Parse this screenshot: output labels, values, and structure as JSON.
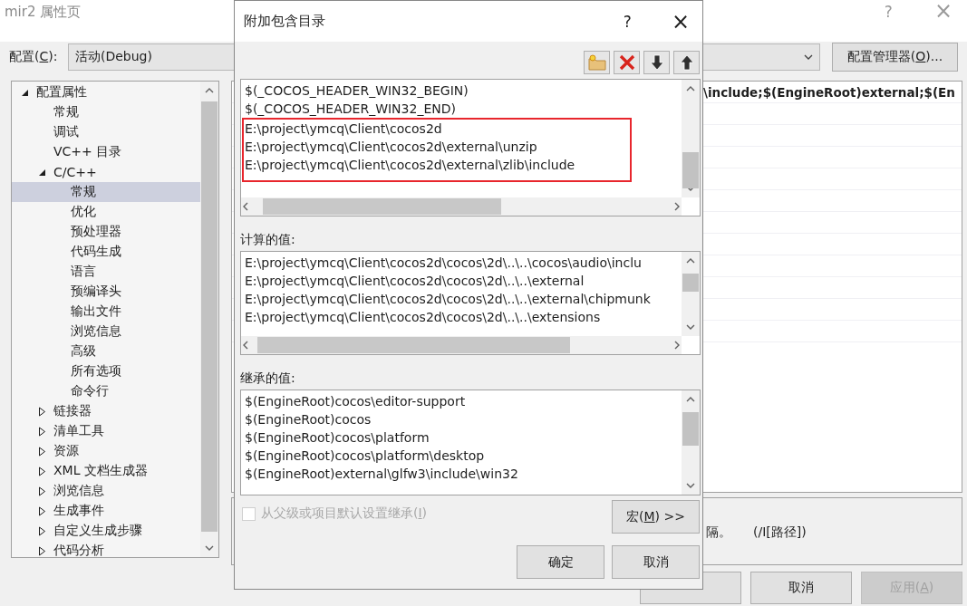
{
  "window": {
    "title": "mir2 属性页",
    "help": "?",
    "close": "×"
  },
  "config": {
    "label": {
      "pre": "配置(",
      "key": "C",
      "post": "):"
    },
    "value": "活动(Debug)",
    "manager_button": {
      "pre": "配置管理器(",
      "key": "O",
      "post": ")..."
    }
  },
  "sidebar": {
    "items": [
      {
        "label": "配置属性",
        "expanded": true,
        "selected": false,
        "children": [
          {
            "label": "常规",
            "selected": false
          },
          {
            "label": "调试",
            "selected": false
          },
          {
            "label": "VC++ 目录",
            "selected": false
          },
          {
            "label": "C/C++",
            "expanded": true,
            "selected": false,
            "children": [
              {
                "label": "常规",
                "selected": true
              },
              {
                "label": "优化",
                "selected": false
              },
              {
                "label": "预处理器",
                "selected": false
              },
              {
                "label": "代码生成",
                "selected": false
              },
              {
                "label": "语言",
                "selected": false
              },
              {
                "label": "预编译头",
                "selected": false
              },
              {
                "label": "输出文件",
                "selected": false
              },
              {
                "label": "浏览信息",
                "selected": false
              },
              {
                "label": "高级",
                "selected": false
              },
              {
                "label": "所有选项",
                "selected": false
              },
              {
                "label": "命令行",
                "selected": false
              }
            ]
          },
          {
            "label": "链接器",
            "expanded": false,
            "selected": false
          },
          {
            "label": "清单工具",
            "expanded": false,
            "selected": false
          },
          {
            "label": "资源",
            "expanded": false,
            "selected": false
          },
          {
            "label": "XML 文档生成器",
            "expanded": false,
            "selected": false
          },
          {
            "label": "浏览信息",
            "expanded": false,
            "selected": false
          },
          {
            "label": "生成事件",
            "expanded": false,
            "selected": false
          },
          {
            "label": "自定义生成步骤",
            "expanded": false,
            "selected": false
          },
          {
            "label": "代码分析",
            "expanded": false,
            "selected": false
          }
        ]
      }
    ]
  },
  "property_grid": {
    "rows": [
      {
        "value": "\\include;$(EngineRoot)external;$(En"
      }
    ]
  },
  "description": {
    "text": "隔。",
    "switch": "(/I[路径])"
  },
  "buttons": [
    {
      "disabled": false
    },
    {
      "label": {
        "pre": "取消"
      },
      "disabled": false
    },
    {
      "label": {
        "pre": "应用(",
        "key": "A",
        "post": ")"
      },
      "disabled": true
    }
  ],
  "dialog": {
    "title": "附加包含目录",
    "help": "?",
    "close": "×",
    "entries": [
      {
        "text": "$(_COCOS_HEADER_WIN32_BEGIN)",
        "highlighted": false
      },
      {
        "text": "$(_COCOS_HEADER_WIN32_END)",
        "highlighted": false
      },
      {
        "text": "E:\\project\\ymcq\\Client\\cocos2d",
        "highlighted": true
      },
      {
        "text": "E:\\project\\ymcq\\Client\\cocos2d\\external\\unzip",
        "highlighted": true
      },
      {
        "text": "E:\\project\\ymcq\\Client\\cocos2d\\external\\zlib\\include",
        "highlighted": true
      }
    ],
    "computed_label": "计算的值:",
    "computed": [
      "E:\\project\\ymcq\\Client\\cocos2d\\cocos\\2d\\..\\..\\cocos\\audio\\inclu",
      "E:\\project\\ymcq\\Client\\cocos2d\\cocos\\2d\\..\\..\\external",
      "E:\\project\\ymcq\\Client\\cocos2d\\cocos\\2d\\..\\..\\external\\chipmunk",
      "E:\\project\\ymcq\\Client\\cocos2d\\cocos\\2d\\..\\..\\extensions"
    ],
    "inherited_label": "继承的值:",
    "inherited": [
      "$(EngineRoot)cocos\\editor-support",
      "$(EngineRoot)cocos",
      "$(EngineRoot)cocos\\platform",
      "$(EngineRoot)cocos\\platform\\desktop",
      "$(EngineRoot)external\\glfw3\\include\\win32"
    ],
    "inherit_checkbox": {
      "label": {
        "pre": "从父级或项目默认设置继承(",
        "key": "I",
        "post": ")"
      },
      "checked": false,
      "disabled": true
    },
    "macro_button": {
      "pre": "宏(",
      "key": "M",
      "post": ") >>"
    },
    "buttons": [
      {
        "pre": "确定"
      },
      {
        "pre": "取消"
      }
    ]
  }
}
